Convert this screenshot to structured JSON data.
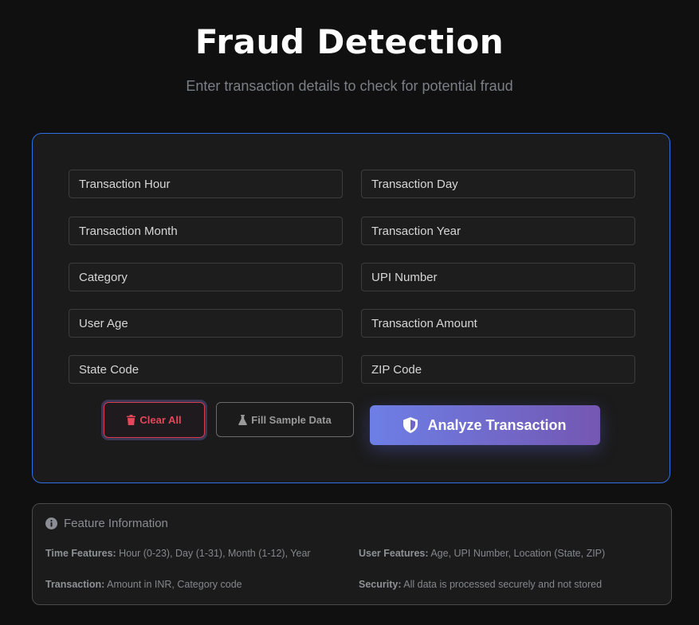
{
  "header": {
    "title": "Fraud Detection",
    "subtitle": "Enter transaction details to check for potential fraud"
  },
  "form": {
    "fields": {
      "transaction_hour": {
        "placeholder": "Transaction Hour",
        "value": ""
      },
      "transaction_day": {
        "placeholder": "Transaction Day",
        "value": ""
      },
      "transaction_month": {
        "placeholder": "Transaction Month",
        "value": ""
      },
      "transaction_year": {
        "placeholder": "Transaction Year",
        "value": ""
      },
      "category": {
        "placeholder": "Category",
        "value": ""
      },
      "upi_number": {
        "placeholder": "UPI Number",
        "value": ""
      },
      "user_age": {
        "placeholder": "User Age",
        "value": ""
      },
      "transaction_amount": {
        "placeholder": "Transaction Amount",
        "value": ""
      },
      "state_code": {
        "placeholder": "State Code",
        "value": ""
      },
      "zip_code": {
        "placeholder": "ZIP Code",
        "value": ""
      }
    },
    "buttons": {
      "clear_label": "Clear All",
      "sample_label": "Fill Sample Data",
      "analyze_label": "Analyze Transaction"
    }
  },
  "info": {
    "title": "Feature Information",
    "items": [
      {
        "label": "Time Features:",
        "text": " Hour (0-23), Day (1-31), Month (1-12), Year"
      },
      {
        "label": "User Features:",
        "text": " Age, UPI Number, Location (State, ZIP)"
      },
      {
        "label": "Transaction:",
        "text": " Amount in INR, Category code"
      },
      {
        "label": "Security:",
        "text": " All data is processed securely and not stored"
      }
    ]
  },
  "colors": {
    "background": "#101010",
    "card_border": "#2e6fe3",
    "clear_red": "#e5475a",
    "analyze_gradient_start": "#6d7fe6",
    "analyze_gradient_end": "#7457b2"
  },
  "icons": {
    "clear": "trash-icon",
    "sample": "flask-icon",
    "analyze": "shield-icon",
    "info": "info-circle-icon"
  }
}
